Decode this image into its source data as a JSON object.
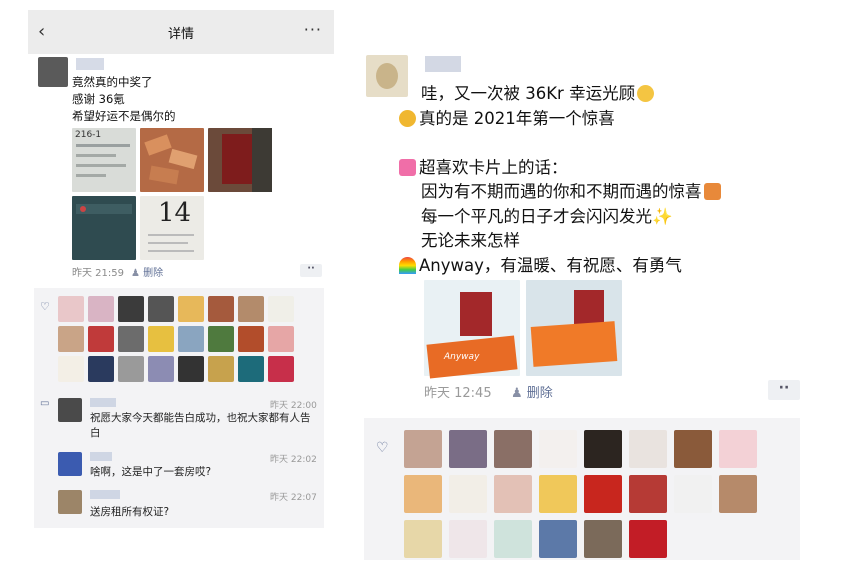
{
  "left_panel": {
    "nav": {
      "back_icon": "‹",
      "title": "详情",
      "more_icon": "···"
    },
    "post": {
      "text_lines": [
        "竟然真的中奖了",
        "感谢 36氪",
        "希望好运不是偶尔的"
      ],
      "time": "昨天 21:59",
      "delete_label": "删除",
      "photo_texts": [
        "216-1",
        "14"
      ]
    },
    "comments": [
      {
        "text": "祝愿大家今天都能告白成功，也祝大家都有人告白",
        "time": "昨天 22:00"
      },
      {
        "text": "啥啊，这是中了一套房哎?",
        "time": "昨天 22:02"
      },
      {
        "text": "送房租所有权证?",
        "time": "昨天 22:07"
      }
    ]
  },
  "right_panel": {
    "post": {
      "text_lines": [
        "哇，又一次被 36Kr 幸运光顾",
        "真的是 2021年第一个惊喜",
        "",
        "超喜欢卡片上的话：",
        "因为有不期而遇的你和不期而遇的惊喜",
        "每一个平凡的日子才会闪闪发光",
        "无论未来怎样",
        "Anyway，有温暖、有祝愿、有勇气"
      ],
      "photo_text": "Anyway",
      "time": "昨天 12:45",
      "delete_label": "删除"
    }
  },
  "colors": {
    "link_blue": "#607096",
    "meta_gray": "#8a8a8a",
    "like_bg": "#f3f3f5"
  }
}
